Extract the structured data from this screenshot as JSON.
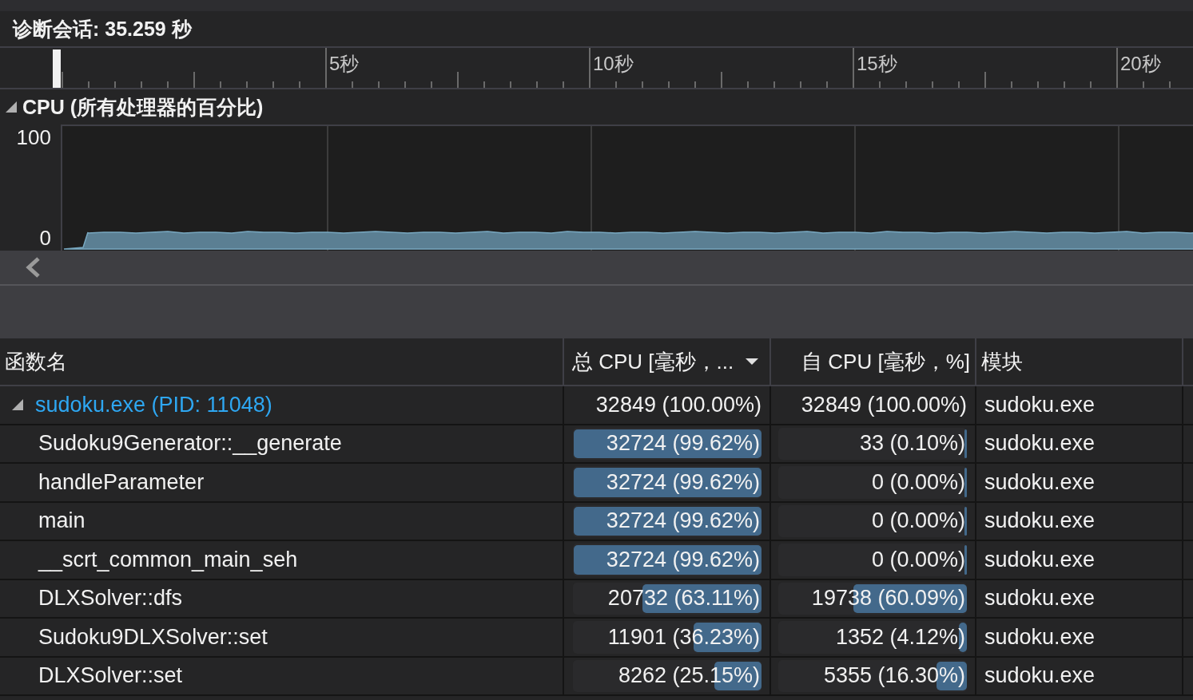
{
  "header": {
    "title": "诊断会话: 35.259 秒"
  },
  "ruler": {
    "labels": [
      "5秒",
      "10秒",
      "15秒",
      "20秒"
    ]
  },
  "cpu_graph": {
    "title": "CPU (所有处理器的百分比)",
    "expanded": true,
    "y_labels": [
      "100",
      "0"
    ]
  },
  "table": {
    "columns": [
      {
        "label": "函数名",
        "sorted": false
      },
      {
        "label": "总 CPU [毫秒，...",
        "sorted": true
      },
      {
        "label": "自 CPU [毫秒，%]",
        "sorted": false
      },
      {
        "label": "模块",
        "sorted": false
      }
    ],
    "rows": [
      {
        "name": "sudoku.exe (PID: 11048)",
        "expanded": true,
        "total": "32849 (100.00%)",
        "self": "32849 (100.00%)",
        "module": "sudoku.exe",
        "children": [
          {
            "name": "Sudoku9Generator::__generate",
            "total": "32724 (99.62%)",
            "total_bar": {
              "level": 0.9962
            },
            "self": "33 (0.10%)",
            "self_bar": {
              "level": 0.001
            },
            "module": "sudoku.exe"
          },
          {
            "name": "handleParameter",
            "total": "32724 (99.62%)",
            "total_bar": {
              "level": 0.9962
            },
            "self": "0 (0.00%)",
            "self_bar": {
              "level": 0
            },
            "module": "sudoku.exe"
          },
          {
            "name": "main",
            "total": "32724 (99.62%)",
            "total_bar": {
              "level": 0.9962
            },
            "self": "0 (0.00%)",
            "self_bar": {
              "level": 0
            },
            "module": "sudoku.exe"
          },
          {
            "name": "__scrt_common_main_seh",
            "total": "32724 (99.62%)",
            "total_bar": {
              "level": 0.9962
            },
            "self": "0 (0.00%)",
            "self_bar": {
              "level": 0
            },
            "module": "sudoku.exe"
          },
          {
            "name": "DLXSolver::dfs",
            "total": "20732 (63.11%)",
            "total_bar": {
              "level": 0.6311
            },
            "self": "19738 (60.09%)",
            "self_bar": {
              "level": 0.6009
            },
            "module": "sudoku.exe"
          },
          {
            "name": "Sudoku9DLXSolver::set",
            "total": "11901 (36.23%)",
            "total_bar": {
              "level": 0.3623
            },
            "self": "1352 (4.12%)",
            "self_bar": {
              "level": 0.0412
            },
            "module": "sudoku.exe"
          },
          {
            "name": "DLXSolver::set",
            "total": "8262 (25.15%)",
            "total_bar": {
              "level": 0.2515
            },
            "self": "5355 (16.30%)",
            "self_bar": {
              "level": 0.163
            },
            "module": "sudoku.exe"
          }
        ]
      }
    ]
  }
}
